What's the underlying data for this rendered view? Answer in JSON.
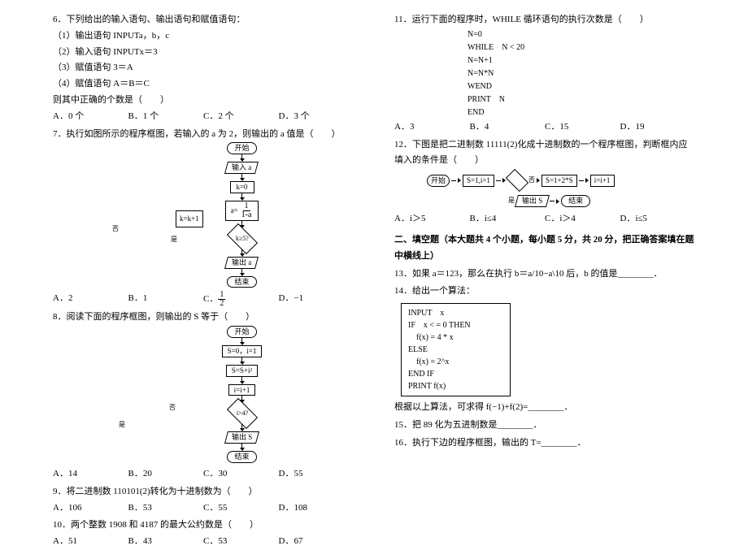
{
  "left": {
    "q6": {
      "stem": "6．下列给出的输入语句、输出语句和赋值语句：",
      "l1": "（1）输出语句 INPUTa，b，c",
      "l2": "（2）输入语句 INPUTx＝3",
      "l3": "（3）赋值语句 3＝A",
      "l4": "（4）赋值语句 A＝B＝C",
      "l5": "则其中正确的个数是（　　）",
      "opts": {
        "a": "A．0 个",
        "b": "B．1 个",
        "c": "C．2 个",
        "d": "D．3 个"
      }
    },
    "q7": {
      "stem": "7．执行如图所示的程序框图，若输入的 a 为 2，则输出的 a 值是（　　）",
      "fc": {
        "start": "开始",
        "in": "输入 a",
        "init": "k=0",
        "assign": "a=",
        "cond": "k≥5?",
        "inc": "k=k+1",
        "out": "输出 a",
        "end": "结束",
        "yes": "是",
        "no": "否",
        "frac_n": "1",
        "frac_d": "1-a"
      },
      "opts": {
        "a": "A．2",
        "b": "B．1",
        "c_pre": "C．",
        "c_n": "1",
        "c_d": "2",
        "d": "D．−1"
      }
    },
    "q8": {
      "stem": "8．阅读下面的程序框图，则输出的 S 等于（　　）",
      "fc": {
        "start": "开始",
        "init": "S=0，i=1",
        "assign": "S=S+i²",
        "inc": "i=i+1",
        "cond": "i>4?",
        "out": "输出 S",
        "end": "结束",
        "yes": "是",
        "no": "否"
      },
      "opts": {
        "a": "A．14",
        "b": "B．20",
        "c": "C．30",
        "d": "D．55"
      }
    },
    "q9": {
      "stem": "9．将二进制数 110101(2)转化为十进制数为（　　）",
      "opts": {
        "a": "A．106",
        "b": "B．53",
        "c": "C．55",
        "d": "D．108"
      }
    },
    "q10": {
      "stem": "10．两个整数 1908 和 4187 的最大公约数是（　　）",
      "opts": {
        "a": "A．51",
        "b": "B．43",
        "c": "C．53",
        "d": "D．67"
      }
    }
  },
  "right": {
    "q11": {
      "stem": "11．运行下面的程序时，WHILE 循环语句的执行次数是（　　）",
      "code": {
        "l1": "N=0",
        "l2": "WHILE　N < 20",
        "l3": "N=N+1",
        "l4": "N=N*N",
        "l5": "WEND",
        "l6": "PRINT　N",
        "l7": "END"
      },
      "opts": {
        "a": "A．3",
        "b": "B．4",
        "c": "C．15",
        "d": "D．19"
      }
    },
    "q12": {
      "stem": "12．下图是把二进制数 11111(2)化成十进制数的一个程序框图，判断框内应填入的条件是（　　）",
      "fc": {
        "start": "开始",
        "init": "S=1,i=1",
        "calc": "S=1+2*S",
        "inc": "i=i+1",
        "out": "输出 S",
        "end": "结束",
        "yes": "是",
        "no": "否"
      },
      "opts": {
        "a": "A．i＞5",
        "b": "B．i≤4",
        "c": "C．i＞4",
        "d": "D．i≤5"
      }
    },
    "section2": "二、填空题（本大题共 4 个小题，每小题 5 分，共 20 分，把正确答案填在题中横线上）",
    "q13": "13．如果 a＝123，那么在执行 b＝a/10−a\\10 后，b 的值是________．",
    "q14": {
      "stem": "14．给出一个算法：",
      "code": {
        "l1": "INPUT　x",
        "l2": "IF　x < = 0 THEN",
        "l3": "　f(x) = 4 * x",
        "l4": "ELSE",
        "l5": "　f(x) = 2^x",
        "l6": "END IF",
        "l7": "PRINT f(x)"
      },
      "post": "根据以上算法，可求得 f(−1)+f(2)=________．"
    },
    "q15": "15．把 89 化为五进制数是________．",
    "q16": "16．执行下边的程序框图，输出的 T=________．"
  }
}
